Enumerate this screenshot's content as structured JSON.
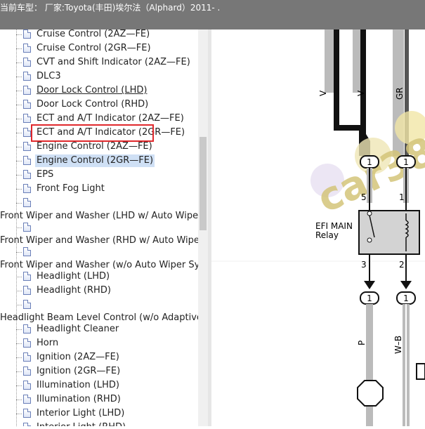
{
  "titlebar": {
    "text": "当前车型： 厂家:Toyota(丰田)埃尔法（Alphard）2011-   ."
  },
  "tree": {
    "items": [
      {
        "label": "Cruise Control (2AZ—FE)",
        "level": 1
      },
      {
        "label": "Cruise Control (2GR—FE)",
        "level": 1
      },
      {
        "label": "CVT and Shift Indicator (2AZ—FE)",
        "level": 1
      },
      {
        "label": "DLC3",
        "level": 1
      },
      {
        "label": "Door Lock Control (LHD)",
        "level": 1
      },
      {
        "label": "Door Lock Control (RHD)",
        "level": 1
      },
      {
        "label": "ECT and A/T Indicator (2AZ—FE)",
        "level": 1
      },
      {
        "label": "ECT and A/T Indicator (2GR—FE)",
        "level": 1
      },
      {
        "label": "Engine Control (2AZ—FE)",
        "level": 1
      },
      {
        "label": "Engine Control (2GR—FE)",
        "level": 1,
        "selected": true
      },
      {
        "label": "EPS",
        "level": 1
      },
      {
        "label": "Front Fog Light",
        "level": 1
      },
      {
        "label": "",
        "level": 1
      },
      {
        "label": "Front Wiper and Washer (LHD w/ Auto Wiper",
        "level": 0
      },
      {
        "label": "",
        "level": 1
      },
      {
        "label": "Front Wiper and Washer (RHD w/ Auto Wiper",
        "level": 0
      },
      {
        "label": "",
        "level": 1
      },
      {
        "label": "Front Wiper and Washer (w/o Auto Wiper Sys",
        "level": 0
      },
      {
        "label": "Headlight (LHD)",
        "level": 1
      },
      {
        "label": "Headlight (RHD)",
        "level": 1
      },
      {
        "label": "",
        "level": 1
      },
      {
        "label": "Headlight Beam Level Control (w/o Adaptive I",
        "level": 0
      },
      {
        "label": "Headlight Cleaner",
        "level": 1
      },
      {
        "label": "Horn",
        "level": 1
      },
      {
        "label": "Ignition (2AZ—FE)",
        "level": 1
      },
      {
        "label": "Ignition (2GR—FE)",
        "level": 1
      },
      {
        "label": "Illumination (LHD)",
        "level": 1
      },
      {
        "label": "Illumination (RHD)",
        "level": 1
      },
      {
        "label": "Interior Light (LHD)",
        "level": 1
      },
      {
        "label": "Interior Light (RHD)",
        "level": 1
      }
    ]
  },
  "diagram": {
    "wire_top_left": "V",
    "wire_top_mid": "V",
    "wire_top_right": "GR",
    "connector_label": "1",
    "pin_5": "5",
    "pin_1": "1",
    "pin_3": "3",
    "pin_2": "2",
    "relay_name_line1": "EFI MAIN",
    "relay_name_line2": "Relay",
    "wire_bottom_left": "P",
    "wire_bottom_right": "W–B",
    "watermark": "car38"
  },
  "colors": {
    "titlebar_bg": "#777777",
    "selection_box": "#e0282c",
    "selection_fill": "#cfe0f5",
    "wire_gray": "#b9b9b9",
    "relay_fill": "#d3d3d3"
  }
}
